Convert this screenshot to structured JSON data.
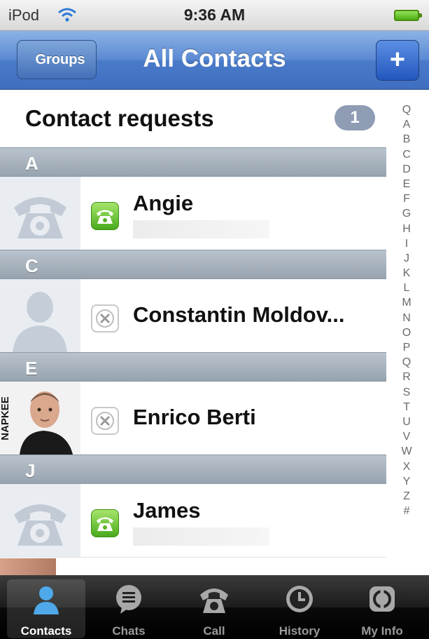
{
  "status_bar": {
    "device": "iPod",
    "time": "9:36 AM"
  },
  "nav_bar": {
    "back_label": "Groups",
    "title": "All Contacts",
    "add_label": "+"
  },
  "requests": {
    "label": "Contact requests",
    "count": "1"
  },
  "sections": [
    {
      "letter": "A",
      "contact": {
        "name": "Angie",
        "status": "online"
      }
    },
    {
      "letter": "C",
      "contact": {
        "name": "Constantin Moldov...",
        "status": "offline"
      }
    },
    {
      "letter": "E",
      "contact": {
        "name": "Enrico Berti",
        "status": "offline",
        "photo_text": "NAPKEE"
      }
    },
    {
      "letter": "J",
      "contact": {
        "name": "James",
        "status": "online"
      }
    }
  ],
  "alpha_index": [
    "Q",
    "A",
    "B",
    "C",
    "D",
    "E",
    "F",
    "G",
    "H",
    "I",
    "J",
    "K",
    "L",
    "M",
    "N",
    "O",
    "P",
    "Q",
    "R",
    "S",
    "T",
    "U",
    "V",
    "W",
    "X",
    "Y",
    "Z",
    "#"
  ],
  "tabs": [
    {
      "label": "Contacts",
      "icon": "contacts-icon",
      "selected": true
    },
    {
      "label": "Chats",
      "icon": "chats-icon"
    },
    {
      "label": "Call",
      "icon": "phone-icon"
    },
    {
      "label": "History",
      "icon": "clock-icon"
    },
    {
      "label": "My Info",
      "icon": "my-info-icon"
    }
  ],
  "colors": {
    "nav_blue": "#4a7bc9",
    "online_green": "#49aa1d",
    "section_gray": "#a6b1bc",
    "tab_selected": "#4fa8ea"
  }
}
